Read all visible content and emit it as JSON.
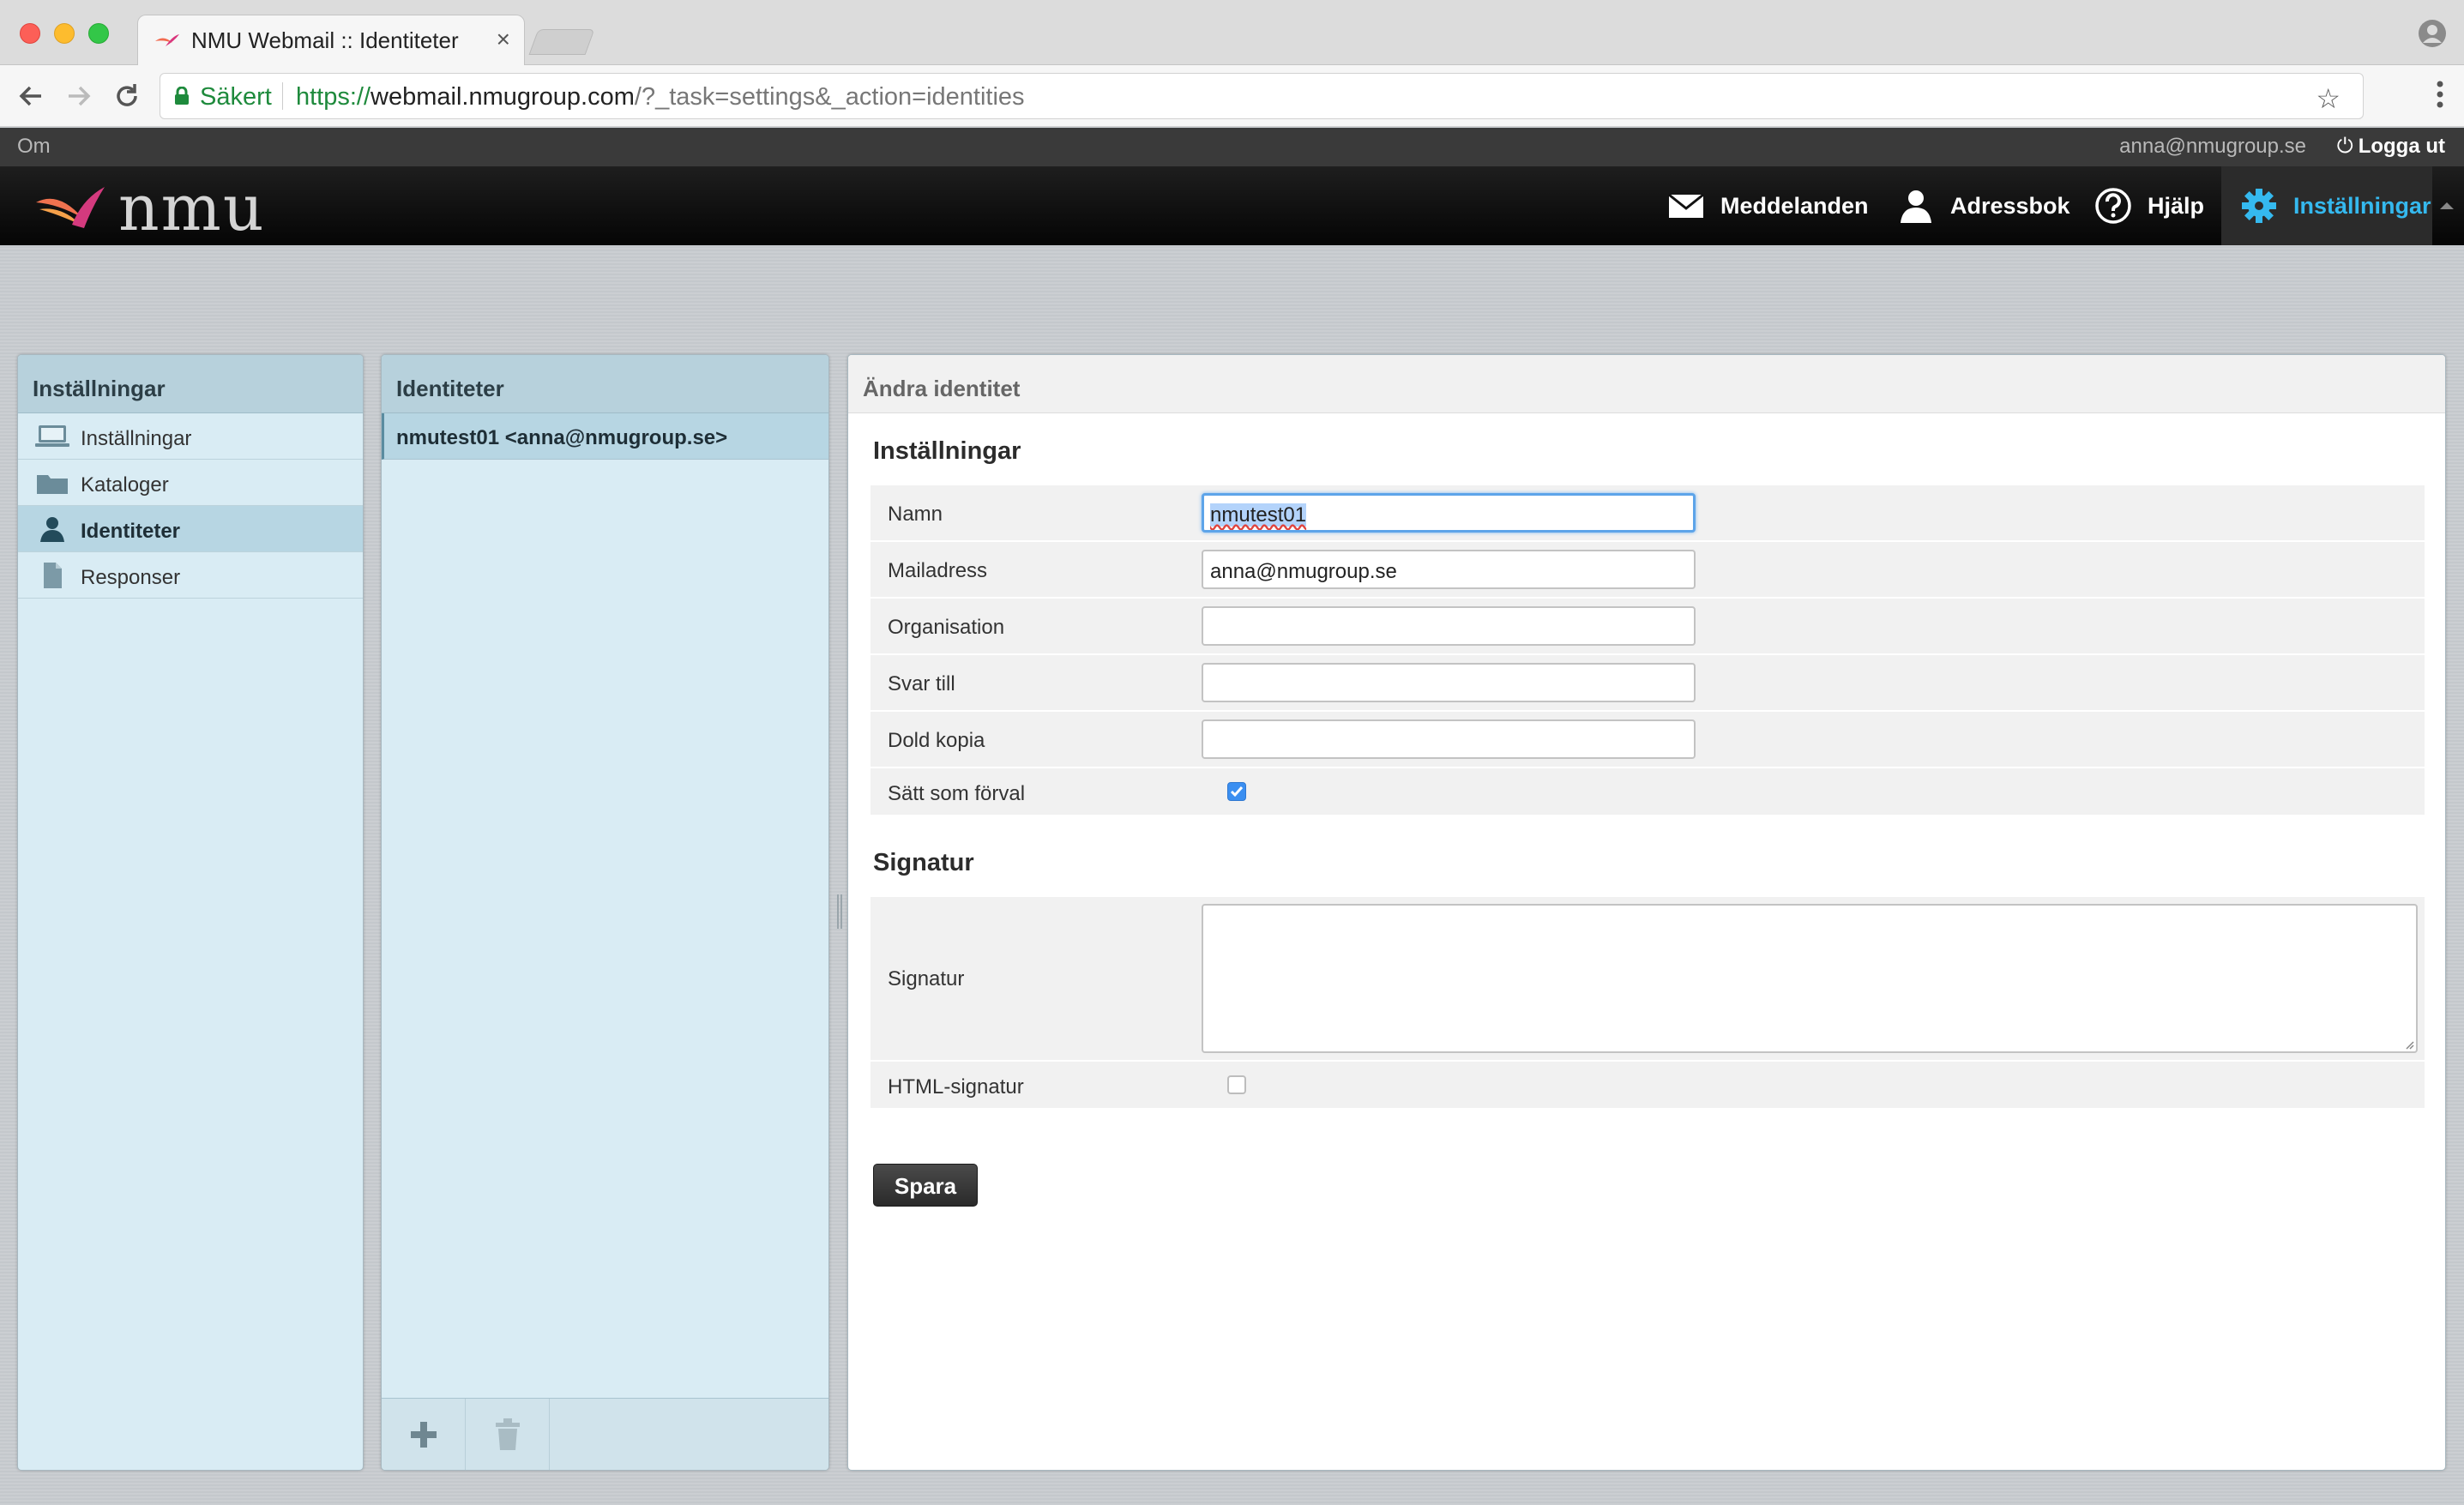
{
  "browser": {
    "tab_title": "NMU Webmail :: Identiteter",
    "tab_close": "×",
    "secure_label": "Säkert",
    "url_protocol": "https://",
    "url_host": "webmail.nmugroup.com",
    "url_path": "/?_task=settings&_action=identities",
    "bookmark_glyph": "☆"
  },
  "topline": {
    "about": "Om",
    "user_email": "anna@nmugroup.se",
    "logout_glyph": "⏻",
    "logout": "Logga ut"
  },
  "header": {
    "logo_text": "nmu",
    "nav": {
      "messages": "Meddelanden",
      "addressbook": "Adressbok",
      "help": "Hjälp",
      "settings": "Inställningar"
    }
  },
  "settings_panel": {
    "title": "Inställningar",
    "items": [
      {
        "label": "Inställningar",
        "icon": "computer-icon"
      },
      {
        "label": "Kataloger",
        "icon": "folder-icon"
      },
      {
        "label": "Identiteter",
        "icon": "person-icon",
        "selected": true
      },
      {
        "label": "Responser",
        "icon": "document-icon"
      }
    ]
  },
  "identities_panel": {
    "title": "Identiteter",
    "items": [
      {
        "label": "nmutest01 <anna@nmugroup.se>",
        "selected": true
      }
    ]
  },
  "edit_panel": {
    "title": "Ändra identitet",
    "section_settings": "Inställningar",
    "fields": {
      "name_label": "Namn",
      "name_value": "nmutest01",
      "email_label": "Mailadress",
      "email_value": "anna@nmugroup.se",
      "org_label": "Organisation",
      "org_value": "",
      "reply_label": "Svar till",
      "reply_value": "",
      "bcc_label": "Dold kopia",
      "bcc_value": "",
      "default_label": "Sätt som förval",
      "default_checked": true
    },
    "section_signature": "Signatur",
    "signature": {
      "label": "Signatur",
      "value": "",
      "html_label": "HTML-signatur",
      "html_checked": false
    },
    "save": "Spara"
  },
  "colors": {
    "accent": "#35b9ef",
    "panel_blue": "#d9ecf4",
    "panel_head": "#b7d1dc",
    "header_bg": "#050505"
  }
}
